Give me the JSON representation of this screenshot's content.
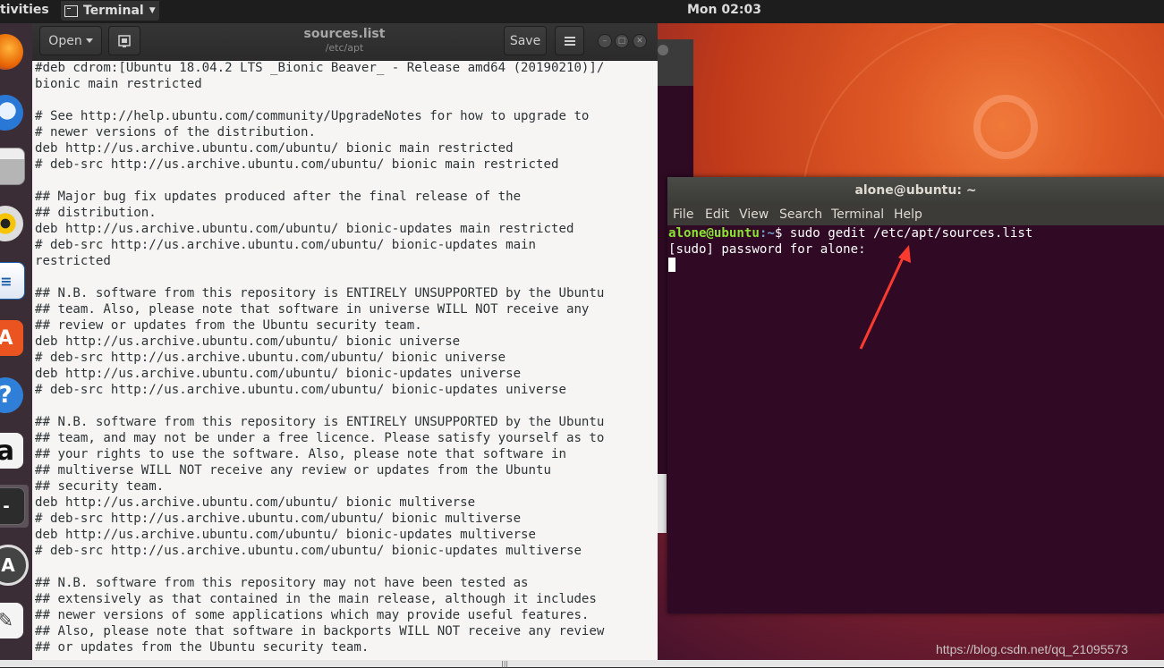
{
  "top_panel": {
    "activities": "tivities",
    "app_menu": "Terminal",
    "clock": "Mon 02:03"
  },
  "dock": {
    "items": [
      "firefox-icon",
      "thunderbird-icon",
      "files-icon",
      "rhythmbox-icon",
      "libreoffice-writer-icon",
      "ubuntu-software-icon",
      "help-icon",
      "amazon-icon",
      "terminal-icon",
      "software-updater-icon",
      "text-editor-icon"
    ]
  },
  "gedit": {
    "open_label": "Open",
    "title": "sources.list",
    "subtitle": "/etc/apt",
    "save_label": "Save",
    "lines": [
      "#deb cdrom:[Ubuntu 18.04.2 LTS _Bionic Beaver_ - Release amd64 (20190210)]/",
      "bionic main restricted",
      "",
      "# See http://help.ubuntu.com/community/UpgradeNotes for how to upgrade to",
      "# newer versions of the distribution.",
      "deb http://us.archive.ubuntu.com/ubuntu/ bionic main restricted",
      "# deb-src http://us.archive.ubuntu.com/ubuntu/ bionic main restricted",
      "",
      "## Major bug fix updates produced after the final release of the",
      "## distribution.",
      "deb http://us.archive.ubuntu.com/ubuntu/ bionic-updates main restricted",
      "# deb-src http://us.archive.ubuntu.com/ubuntu/ bionic-updates main",
      "restricted",
      "",
      "## N.B. software from this repository is ENTIRELY UNSUPPORTED by the Ubuntu",
      "## team. Also, please note that software in universe WILL NOT receive any",
      "## review or updates from the Ubuntu security team.",
      "deb http://us.archive.ubuntu.com/ubuntu/ bionic universe",
      "# deb-src http://us.archive.ubuntu.com/ubuntu/ bionic universe",
      "deb http://us.archive.ubuntu.com/ubuntu/ bionic-updates universe",
      "# deb-src http://us.archive.ubuntu.com/ubuntu/ bionic-updates universe",
      "",
      "## N.B. software from this repository is ENTIRELY UNSUPPORTED by the Ubuntu",
      "## team, and may not be under a free licence. Please satisfy yourself as to",
      "## your rights to use the software. Also, please note that software in",
      "## multiverse WILL NOT receive any review or updates from the Ubuntu",
      "## security team.",
      "deb http://us.archive.ubuntu.com/ubuntu/ bionic multiverse",
      "# deb-src http://us.archive.ubuntu.com/ubuntu/ bionic multiverse",
      "deb http://us.archive.ubuntu.com/ubuntu/ bionic-updates multiverse",
      "# deb-src http://us.archive.ubuntu.com/ubuntu/ bionic-updates multiverse",
      "",
      "## N.B. software from this repository may not have been tested as",
      "## extensively as that contained in the main release, although it includes",
      "## newer versions of some applications which may provide useful features.",
      "## Also, please note that software in backports WILL NOT receive any review",
      "## or updates from the Ubuntu security team."
    ]
  },
  "terminal": {
    "title": "alone@ubuntu: ~",
    "menu": [
      "File",
      "Edit",
      "View",
      "Search",
      "Terminal",
      "Help"
    ],
    "prompt_user": "alone@ubuntu",
    "prompt_path": ":~",
    "prompt_symbol": "$",
    "command": " sudo gedit /etc/apt/sources.list",
    "sudo_prompt": "[sudo] password for alone:"
  },
  "annotation": {
    "arrow_color": "#ff3b30"
  },
  "watermark": "https://blog.csdn.net/qq_21095573",
  "colors": {
    "terminal_bg": "#300a24",
    "prompt_user": "#8ae234",
    "prompt_path": "#729fcf",
    "ubuntu_orange": "#e95420"
  }
}
